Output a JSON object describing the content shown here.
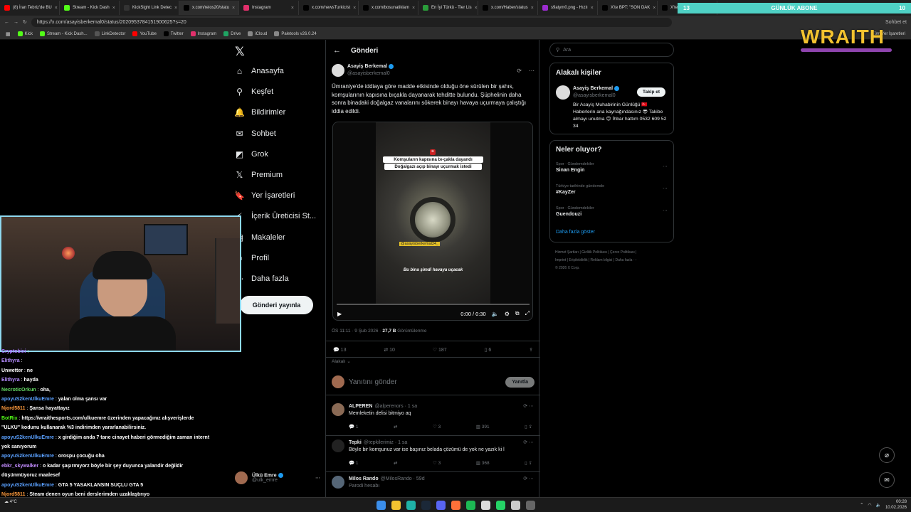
{
  "browser": {
    "tabs": [
      {
        "label": "(8) İran Tebriz'de BU",
        "color": "#ff0000"
      },
      {
        "label": "Stream - Kick Dash",
        "color": "#53fc18"
      },
      {
        "label": "KickSight Link Detec",
        "color": "#333333"
      },
      {
        "label": "x.com/reios20/statu",
        "color": "#000000"
      },
      {
        "label": "Instagram",
        "color": "#e1306c"
      },
      {
        "label": "x.com/newsTurkic/st",
        "color": "#000000"
      },
      {
        "label": "x.com/bosunatiklam",
        "color": "#000000"
      },
      {
        "label": "En İyi Türkü - Tier Lis",
        "color": "#2a9d3a"
      },
      {
        "label": "x.com/Haber/status",
        "color": "#000000"
      },
      {
        "label": "s9atym0.png - Hızlı",
        "color": "#9b2ccf"
      },
      {
        "label": "X'te BPT: \"SON DAK",
        "color": "#000000"
      },
      {
        "label": "X'te A",
        "color": "#000000"
      }
    ],
    "url": "https://x.com/asayisberkemal0/status/2020953784151900625?s=20",
    "profile_label": "Sohbet et",
    "bookmarks": [
      {
        "label": "Kick",
        "color": "#53fc18"
      },
      {
        "label": "Stream - Kick Dash...",
        "color": "#53fc18"
      },
      {
        "label": "LinkDetector",
        "color": "#555555"
      },
      {
        "label": "YouTube",
        "color": "#ff0000"
      },
      {
        "label": "Twitter",
        "color": "#000000"
      },
      {
        "label": "Instagram",
        "color": "#e1306c"
      },
      {
        "label": "Drive",
        "color": "#1fa463"
      },
      {
        "label": "iCloud",
        "color": "#888888"
      },
      {
        "label": "Paletools v26.0.24",
        "color": "#888888"
      }
    ],
    "bookmarks_right": "Tüm Yer İşaretleri"
  },
  "overlay": {
    "sub_left": "13",
    "sub_title": "GÜNLÜK ABONE",
    "sub_right": "10",
    "brand": "WRAITH"
  },
  "nav": {
    "items": [
      {
        "label": "Anasayfa",
        "icon": "home-icon",
        "glyph": "⌂"
      },
      {
        "label": "Keşfet",
        "icon": "search-icon",
        "glyph": "⚲"
      },
      {
        "label": "Bildirimler",
        "icon": "bell-icon",
        "glyph": "🔔"
      },
      {
        "label": "Sohbet",
        "icon": "chat-icon",
        "glyph": "✉"
      },
      {
        "label": "Grok",
        "icon": "grok-icon",
        "glyph": "◩"
      },
      {
        "label": "Premium",
        "icon": "x-premium-icon",
        "glyph": "𝕏"
      },
      {
        "label": "Yer İşaretleri",
        "icon": "bookmark-icon",
        "glyph": "🔖"
      },
      {
        "label": "İçerik Üreticisi St...",
        "icon": "creator-icon",
        "glyph": "⚡"
      },
      {
        "label": "Makaleler",
        "icon": "article-icon",
        "glyph": "▤"
      },
      {
        "label": "Profil",
        "icon": "profile-icon",
        "glyph": "☺"
      },
      {
        "label": "Daha fazla",
        "icon": "more-icon",
        "glyph": "⋯"
      }
    ],
    "post_button": "Gönderi yayınla",
    "account": {
      "name": "Ülkü Emre",
      "handle": "@ulk_emre"
    }
  },
  "main": {
    "header": "Gönderi",
    "post": {
      "author": "Asayiş Berkemal",
      "handle": "@asayisberkemal0",
      "text": "Ümraniye'de iddiaya göre madde etkisinde olduğu öne sürülen bir şahıs, komşularının kapısına bıçakla dayanarak tehditte bulundu. Şüphelinin daha sonra binadaki doğalgaz vanalarını sökerek binayı havaya uçurmaya çalıştığı iddia edildi.",
      "video_caption_1": "Komşuların kapısına bı-çakla dayandı",
      "video_caption_2": "Doğalgazı açıp binayı uçurmak istedi",
      "video_watermark": "@asayisberkemal34_",
      "video_subtitle": "Bu bina şimdi havaya uçacak",
      "video_time": "0:00 / 0:30",
      "video_progress": 0.0,
      "meta_time": "ÖS 11:11 · 9 Şub 2026 · ",
      "meta_views": "27,7 B",
      "meta_views_label": " Görüntülenme",
      "replies": "13",
      "reposts": "10",
      "likes": "187",
      "bookmarks": "6",
      "relevance": "Alakalı",
      "reply_placeholder": "Yanıtını gönder",
      "reply_button": "Yanıtla"
    },
    "replies": [
      {
        "name": "ALPEREN",
        "handle": "@alperenors · 1 sa",
        "text": "Memleketin delisi bitmiyo aq",
        "replies": "1",
        "reposts": "",
        "likes": "3",
        "views": "391",
        "avatar": "#8a6a55"
      },
      {
        "name": "Tepki",
        "handle": "@tepkilerimiz · 1 sa",
        "text": "Böyle bir komşunuz var ise başınız belada çözümü de yok ne yazık ki l",
        "replies": "1",
        "reposts": "",
        "likes": "3",
        "views": "368",
        "avatar": "#222222"
      },
      {
        "name": "Milos Rando",
        "handle": "@MilosRando · 59d",
        "text": "Parodi hesabı",
        "replies": "",
        "reposts": "",
        "likes": "",
        "views": "",
        "avatar": "#556677"
      }
    ]
  },
  "right": {
    "search_placeholder": "Ara",
    "people_title": "Alakalı kişiler",
    "person": {
      "name": "Asayiş Berkemal",
      "handle": "@asayisberkemal0",
      "follow": "Takip et",
      "bio": "Bir Asayiş Muhabirinin Günlüğü 🇹🇷 Haberlerin ana kaynağındasınız 😎 Takibe almayı unutma 😉 İhbar hattım 0532 609 52 34"
    },
    "trends_title": "Neler oluyor?",
    "trends": [
      {
        "context": "Spor · Gündemdekiler",
        "name": "Sinan Engin"
      },
      {
        "context": "Türkiye tarihinde gündemde",
        "name": "#KayZer"
      },
      {
        "context": "Spor · Gündemdekiler",
        "name": "Guendouzi"
      }
    ],
    "show_more": "Daha fazla göster",
    "footer_1": "Hizmet Şartları | Gizlilik Politikası | Çerez Politikası |",
    "footer_2": "Imprint | Erişilebilirlik | Reklam bilgisi | Daha fazla ···",
    "footer_3": "© 2026 X Corp."
  },
  "chat": [
    {
      "name": "Cryptobixi",
      "color": "#a970ff",
      "text": ""
    },
    {
      "name": "Elithyra",
      "color": "#b58cff",
      "text": ""
    },
    {
      "name": "Unwetter",
      "color": "#ffffff",
      "text": "ne"
    },
    {
      "name": "Elithyra",
      "color": "#b58cff",
      "text": "hayda"
    },
    {
      "name": "NecroticOrkun",
      "color": "#66dd66",
      "text": "oha,"
    },
    {
      "name": "apoyuS2kenUlkuEmre",
      "color": "#5aa0ff",
      "text": "yalan olma şansı var"
    },
    {
      "name": "Njord5811",
      "color": "#ff9b3d",
      "text": "Şansa hayattayız"
    },
    {
      "name": "BotRix",
      "color": "#53fc18",
      "text": "https://wraithesports.com/ulkuemre üzerinden yapacağınız alışverişlerde \"ULKU\" kodunu kullanarak %3 indirimden yararlanabilirsiniz."
    },
    {
      "name": "apoyuS2kenUlkuEmre",
      "color": "#5aa0ff",
      "text": "x girdiğim anda 7 tane cinayet haberi görmediğim zaman internt yok sanıyorum"
    },
    {
      "name": "apoyuS2kenUlkuEmre",
      "color": "#5aa0ff",
      "text": "orospu çocuğu oha"
    },
    {
      "name": "ebkr_skywalker",
      "color": "#c38cff",
      "text": "o kadar şaşırmıyorz böyle bir şey duyunca yalandir değildir düşünmüyoruz maalesef"
    },
    {
      "name": "apoyuS2kenUlkuEmre",
      "color": "#5aa0ff",
      "text": "GTA 5 YASAKLANSIN SUÇLU GTA 5"
    },
    {
      "name": "Njord5811",
      "color": "#ff9b3d",
      "text": "Steam denen oyun beni derslerimden uzaklaştırıyo"
    }
  ],
  "taskbar": {
    "icons": [
      {
        "name": "windows-icon",
        "color": "#3b8eea"
      },
      {
        "name": "file-explorer-icon",
        "color": "#f2c230"
      },
      {
        "name": "edge-icon",
        "color": "#1fb2a6"
      },
      {
        "name": "steam-icon",
        "color": "#1b2838"
      },
      {
        "name": "discord-icon",
        "color": "#5865f2"
      },
      {
        "name": "firefox-icon",
        "color": "#ff7139"
      },
      {
        "name": "spotify-icon",
        "color": "#1db954"
      },
      {
        "name": "chrome-icon",
        "color": "#dddddd"
      },
      {
        "name": "whatsapp-icon",
        "color": "#25d366"
      },
      {
        "name": "chrome-icon",
        "color": "#cccccc"
      },
      {
        "name": "obs-icon",
        "color": "#666666"
      }
    ],
    "time": "00:28",
    "date": "10.02.2026",
    "weather": "4°C"
  }
}
